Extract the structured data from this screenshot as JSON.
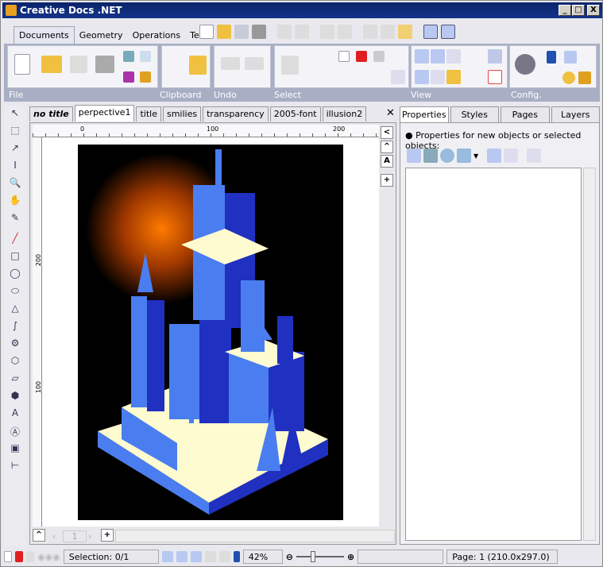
{
  "window": {
    "title": "Creative Docs .NET",
    "minimize": "_",
    "maximize": "□",
    "close": "X"
  },
  "ribbon": {
    "tabs": [
      {
        "label": "Documents",
        "active": true
      },
      {
        "label": "Geometry"
      },
      {
        "label": "Operations"
      },
      {
        "label": "Text"
      }
    ],
    "groups": [
      {
        "label": "File"
      },
      {
        "label": "Clipboard"
      },
      {
        "label": "Undo"
      },
      {
        "label": "Select"
      },
      {
        "label": "View"
      },
      {
        "label": "Config."
      }
    ]
  },
  "document_tabs": [
    {
      "label": "no title",
      "italic": true
    },
    {
      "label": "perpective1",
      "active": true
    },
    {
      "label": "title"
    },
    {
      "label": "smilies"
    },
    {
      "label": "transparency"
    },
    {
      "label": "2005-font"
    },
    {
      "label": "illusion2"
    }
  ],
  "close_doc": "✕",
  "ruler": {
    "h_labels": [
      "0",
      "100",
      "200"
    ],
    "v_labels": [
      "200",
      "100"
    ]
  },
  "page_nav": {
    "page": "1"
  },
  "right_panel": {
    "tabs": [
      {
        "label": "Properties",
        "active": true
      },
      {
        "label": "Styles"
      },
      {
        "label": "Pages"
      },
      {
        "label": "Layers"
      }
    ],
    "hint": "● Properties for new objects or selected objects:"
  },
  "status": {
    "selection": "Selection: 0/1",
    "zoom": "42%",
    "page": "Page: 1 (210.0x297.0)"
  },
  "colors": {
    "title_bar": "#0a246a",
    "ribbon": "#a8aec4",
    "building": "#4a7ef0",
    "shadow": "#2030c0",
    "light": "#fffbd0",
    "glow": "#ff7a00"
  }
}
